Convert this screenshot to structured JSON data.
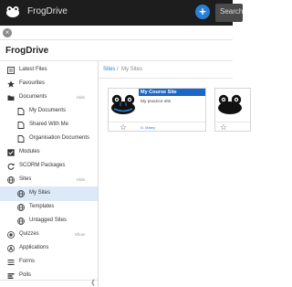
{
  "header": {
    "app_name": "FrogDrive",
    "add_label": "+",
    "search_label": "Search"
  },
  "panel": {
    "close_label": "×",
    "title": "FrogDrive"
  },
  "sidebar": {
    "items": [
      {
        "label": "Latest Files",
        "icon": "latest-files-icon"
      },
      {
        "label": "Favourites",
        "icon": "star-icon"
      },
      {
        "label": "Documents",
        "icon": "folder-icon",
        "hint": "Hide"
      },
      {
        "label": "My Documents",
        "icon": "document-icon"
      },
      {
        "label": "Shared With Me",
        "icon": "document-icon"
      },
      {
        "label": "Organisation Documents",
        "icon": "document-icon"
      },
      {
        "label": "Modules",
        "icon": "checkbox-icon"
      },
      {
        "label": "SCORM Packages",
        "icon": "refresh-icon"
      },
      {
        "label": "Sites",
        "icon": "globe-icon",
        "hint": "Hide"
      },
      {
        "label": "My Sites",
        "icon": "globe-icon"
      },
      {
        "label": "Templates",
        "icon": "globe-icon"
      },
      {
        "label": "Untagged Sites",
        "icon": "globe-icon"
      },
      {
        "label": "Quizzes",
        "icon": "quiz-icon",
        "hint": "Show"
      },
      {
        "label": "Applications",
        "icon": "applications-icon"
      },
      {
        "label": "Forms",
        "icon": "forms-icon"
      },
      {
        "label": "Polls",
        "icon": "polls-icon"
      }
    ],
    "active_label": "My Sites"
  },
  "breadcrumb": {
    "root": "Sites",
    "separator": "/",
    "current": "My Sites"
  },
  "sites": [
    {
      "title": "My Course Site",
      "description": "My practice site",
      "owner": "D. Matey"
    },
    {
      "title": "",
      "description": "",
      "owner": ""
    }
  ],
  "colors": {
    "topbar": "#1d1d1d",
    "accent": "#1b66c7",
    "active_bg": "#dce9f7"
  }
}
